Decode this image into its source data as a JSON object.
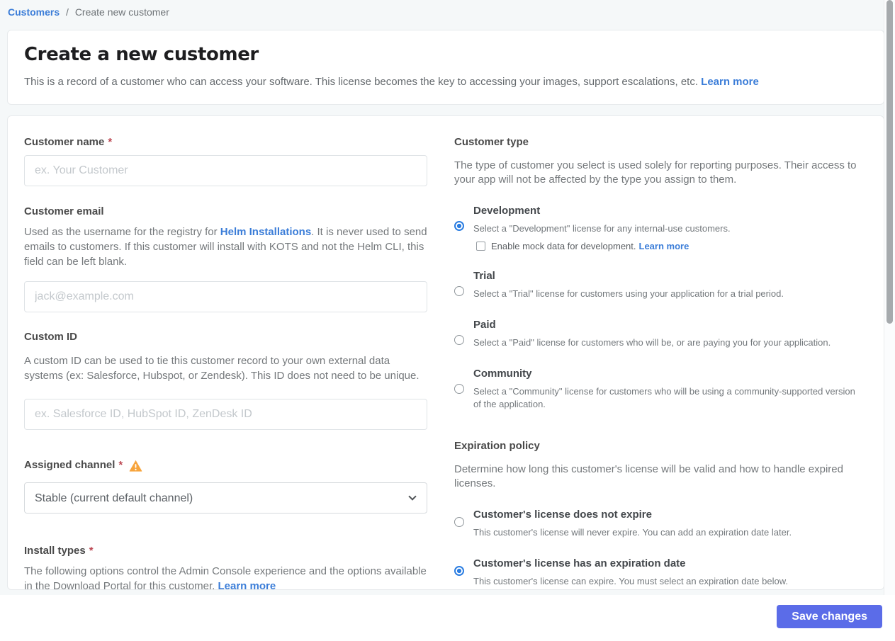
{
  "breadcrumb": {
    "link": "Customers",
    "separator": "/",
    "current": "Create new customer"
  },
  "header": {
    "title": "Create a new customer",
    "description": "This is a record of a customer who can access your software. This license becomes the key to accessing your images, support escalations, etc.",
    "learn_more": "Learn more"
  },
  "form": {
    "customer_name": {
      "label": "Customer name",
      "required": "*",
      "value": "",
      "placeholder": "ex. Your Customer"
    },
    "customer_email": {
      "label": "Customer email",
      "help_before": "Used as the username for the registry for ",
      "help_link": "Helm Installations",
      "help_after": ". It is never used to send emails to customers. If this customer will install with KOTS and not the Helm CLI, this field can be left blank.",
      "value": "",
      "placeholder": "jack@example.com"
    },
    "custom_id": {
      "label": "Custom ID",
      "help": "A custom ID can be used to tie this customer record to your own external data systems (ex: Salesforce, Hubspot, or Zendesk). This ID does not need to be unique.",
      "value": "",
      "placeholder": "ex. Salesforce ID, HubSpot ID, ZenDesk ID"
    },
    "assigned_channel": {
      "label": "Assigned channel",
      "required": "*",
      "selected_option": "Stable (current default channel)"
    },
    "install_types": {
      "label": "Install types",
      "required": "*",
      "help": "The following options control the Admin Console experience and the options available in the Download Portal for this customer.",
      "learn_more": "Learn more"
    }
  },
  "customer_type": {
    "heading": "Customer type",
    "description": "The type of customer you select is used solely for reporting purposes. Their access to your app will not be affected by the type you assign to them.",
    "options": [
      {
        "title": "Development",
        "description": "Select a \"Development\" license for any internal-use customers.",
        "selected": true,
        "checkbox_label": "Enable mock data for development.",
        "checkbox_link": "Learn more",
        "checkbox_checked": false
      },
      {
        "title": "Trial",
        "description": "Select a \"Trial\" license for customers using your application for a trial period.",
        "selected": false
      },
      {
        "title": "Paid",
        "description": "Select a \"Paid\" license for customers who will be, or are paying you for your application.",
        "selected": false
      },
      {
        "title": "Community",
        "description": "Select a \"Community\" license for customers who will be using a community-supported version of the application.",
        "selected": false
      }
    ]
  },
  "expiration_policy": {
    "heading": "Expiration policy",
    "description": "Determine how long this customer's license will be valid and how to handle expired licenses.",
    "options": [
      {
        "title": "Customer's license does not expire",
        "description": "This customer's license will never expire. You can add an expiration date later.",
        "selected": false
      },
      {
        "title": "Customer's license has an expiration date",
        "description": "This customer's license can expire. You must select an expiration date below.",
        "selected": true
      }
    ]
  },
  "footer": {
    "save_button": "Save changes"
  },
  "icons": {
    "warning": "warning-triangle",
    "select_chevron": "chevron-down"
  },
  "colors": {
    "link_blue": "#3b7dd8",
    "radio_selected_blue": "#2b7de1",
    "save_button_indigo": "#5b6ce8",
    "required_red": "#bc4752",
    "warning_orange": "#f7a43c",
    "page_background": "#f5f8f9"
  }
}
